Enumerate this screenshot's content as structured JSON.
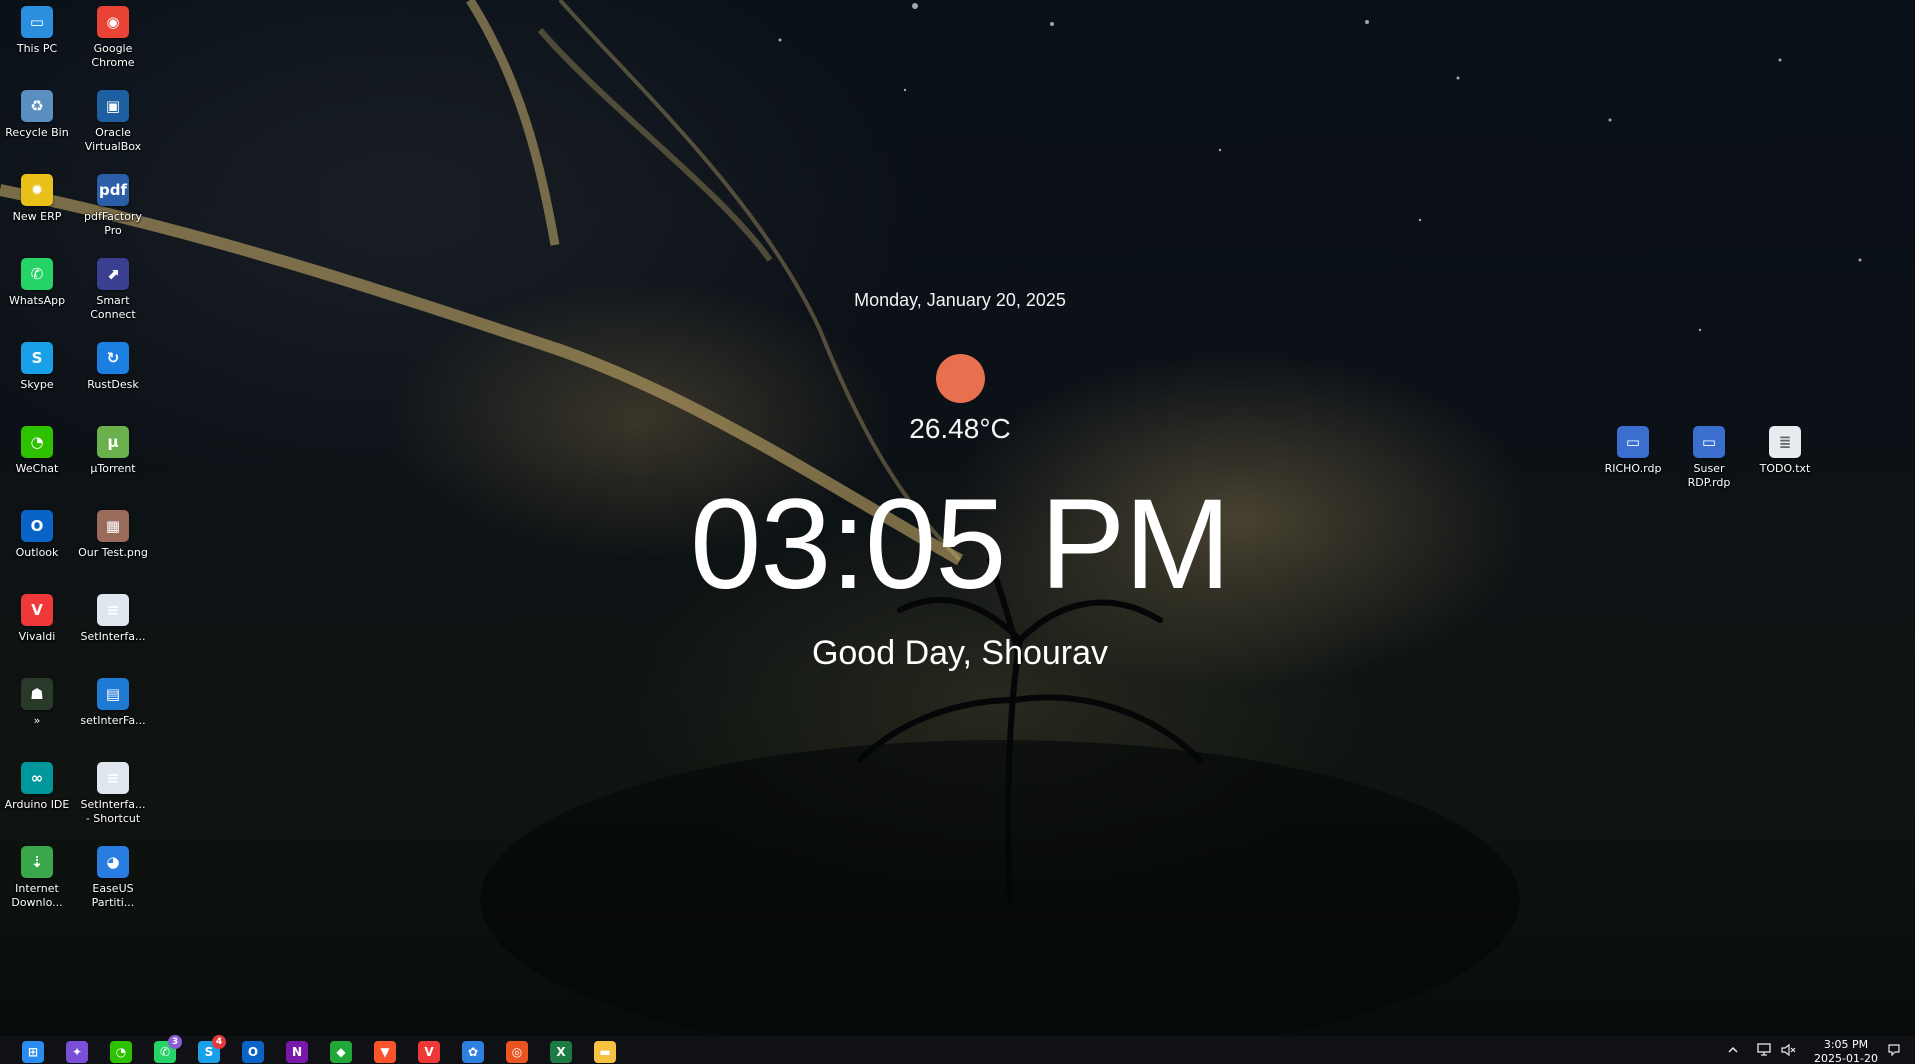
{
  "desktop": {
    "left_icons": [
      {
        "name": "this-pc",
        "label": "This PC",
        "icon": "monitor-icon",
        "color": "#2b8fe0",
        "glyph": "▭"
      },
      {
        "name": "google-chrome",
        "label": "Google\nChrome",
        "icon": "chrome-icon",
        "color": "#e84335",
        "glyph": "◉"
      },
      {
        "name": "recycle-bin",
        "label": "Recycle Bin",
        "icon": "recycle-bin-icon",
        "color": "#5a8fbf",
        "glyph": "♻"
      },
      {
        "name": "oracle-virtualbox",
        "label": "Oracle\nVirtualBox",
        "icon": "virtualbox-icon",
        "color": "#1d5fa0",
        "glyph": "▣"
      },
      {
        "name": "new-erp",
        "label": "New ERP",
        "icon": "erp-icon",
        "color": "#e8c21a",
        "glyph": "✹"
      },
      {
        "name": "pdffactory-pro",
        "label": "pdfFactory\nPro",
        "icon": "pdffactory-icon",
        "color": "#2a5ea8",
        "glyph": "pdf"
      },
      {
        "name": "whatsapp",
        "label": "WhatsApp",
        "icon": "whatsapp-icon",
        "color": "#25d366",
        "glyph": "✆"
      },
      {
        "name": "smart-connect",
        "label": "Smart\nConnect",
        "icon": "smart-connect-icon",
        "color": "#3a3f8f",
        "glyph": "⬈"
      },
      {
        "name": "skype",
        "label": "Skype",
        "icon": "skype-icon",
        "color": "#1aa0e8",
        "glyph": "S"
      },
      {
        "name": "rustdesk",
        "label": "RustDesk",
        "icon": "rustdesk-icon",
        "color": "#1a7fe0",
        "glyph": "↻"
      },
      {
        "name": "wechat",
        "label": "WeChat",
        "icon": "wechat-icon",
        "color": "#2dc100",
        "glyph": "◔"
      },
      {
        "name": "utorrent",
        "label": "µTorrent",
        "icon": "utorrent-icon",
        "color": "#6ab04c",
        "glyph": "µ"
      },
      {
        "name": "outlook",
        "label": "Outlook",
        "icon": "outlook-icon",
        "color": "#0a64c8",
        "glyph": "O"
      },
      {
        "name": "our-test-png",
        "label": "Our Test.png",
        "icon": "image-file-icon",
        "color": "#9a6a5a",
        "glyph": "▦"
      },
      {
        "name": "vivaldi",
        "label": "Vivaldi",
        "icon": "vivaldi-icon",
        "color": "#ef3939",
        "glyph": "V"
      },
      {
        "name": "setinterfa-1",
        "label": "SetInterfa...",
        "icon": "script-file-icon",
        "color": "#dfe6ee",
        "glyph": "≡"
      },
      {
        "name": "shortcut-unnamed",
        "label": "»",
        "icon": "shortcut-icon",
        "color": "#2a3a2a",
        "glyph": "☗"
      },
      {
        "name": "setinterfa-2",
        "label": "setInterFa...",
        "icon": "document-file-icon",
        "color": "#1f7ad4",
        "glyph": "▤"
      },
      {
        "name": "arduino-ide",
        "label": "Arduino IDE",
        "icon": "arduino-icon",
        "color": "#00979c",
        "glyph": "∞"
      },
      {
        "name": "setinterfa-shortcut",
        "label": "SetInterfa...\n- Shortcut",
        "icon": "script-shortcut-icon",
        "color": "#dfe6ee",
        "glyph": "≡"
      },
      {
        "name": "internet-download-manager",
        "label": "Internet\nDownlo...",
        "icon": "idm-icon",
        "color": "#3aa84a",
        "glyph": "⇣"
      },
      {
        "name": "easeus-partition",
        "label": "EaseUS\nPartiti...",
        "icon": "easeus-icon",
        "color": "#2a7de0",
        "glyph": "◕"
      }
    ],
    "right_icons": [
      {
        "name": "richo-rdp",
        "label": "RICHO.rdp",
        "icon": "rdp-file-icon",
        "color": "#3a6fd0",
        "glyph": "▭"
      },
      {
        "name": "suser-rdp",
        "label": "Suser\nRDP.rdp",
        "icon": "rdp-file-icon",
        "color": "#3a6fd0",
        "glyph": "▭"
      },
      {
        "name": "todo-txt",
        "label": "TODO.txt",
        "icon": "text-file-icon",
        "color": "#e8ecf0",
        "glyph": "≣"
      }
    ]
  },
  "widget": {
    "date": "Monday, January 20, 2025",
    "weather_icon": "sun-icon",
    "sun_color": "#e8704f",
    "temperature": "26.48°C",
    "time": "03:05 PM",
    "greeting": "Good Day, Shourav"
  },
  "taskbar": {
    "apps": [
      {
        "name": "start",
        "icon": "windows-start-icon",
        "color": "#2a8cf0",
        "glyph": "⊞",
        "badge": ""
      },
      {
        "name": "copilot-app",
        "icon": "copilot-icon",
        "color": "#7a4fd8",
        "glyph": "✦",
        "badge": ""
      },
      {
        "name": "wechat-app",
        "icon": "wechat-icon",
        "color": "#2dc100",
        "glyph": "◔",
        "badge": ""
      },
      {
        "name": "whatsapp-app",
        "icon": "whatsapp-icon",
        "color": "#25d366",
        "glyph": "✆",
        "badge": "3"
      },
      {
        "name": "skype-app",
        "icon": "skype-icon",
        "color": "#1aa0e8",
        "glyph": "S",
        "badge": "4"
      },
      {
        "name": "outlook-app",
        "icon": "outlook-icon",
        "color": "#0a64c8",
        "glyph": "O",
        "badge": ""
      },
      {
        "name": "onenote-app",
        "icon": "onenote-icon",
        "color": "#7719aa",
        "glyph": "N",
        "badge": ""
      },
      {
        "name": "anydesk-app",
        "icon": "remote-desktop-icon",
        "color": "#20a83a",
        "glyph": "◆",
        "badge": ""
      },
      {
        "name": "brave-app",
        "icon": "brave-icon",
        "color": "#fb542b",
        "glyph": "▼",
        "badge": ""
      },
      {
        "name": "vivaldi-app",
        "icon": "vivaldi-icon",
        "color": "#ef3939",
        "glyph": "V",
        "badge": ""
      },
      {
        "name": "photos-app",
        "icon": "photos-icon",
        "color": "#2d7fe0",
        "glyph": "✿",
        "badge": ""
      },
      {
        "name": "ubuntu-app",
        "icon": "ubuntu-icon",
        "color": "#e95420",
        "glyph": "◎",
        "badge": ""
      },
      {
        "name": "excel-app",
        "icon": "excel-icon",
        "color": "#1d7a45",
        "glyph": "X",
        "badge": ""
      },
      {
        "name": "file-explorer-app",
        "icon": "folder-icon",
        "color": "#f5c242",
        "glyph": "▬",
        "badge": ""
      }
    ],
    "tray": {
      "chevron_icon": "chevron-up-icon",
      "network_icon": "network-icon",
      "volume_icon": "volume-muted-icon",
      "time": "3:05 PM",
      "date": "2025-01-20",
      "notification_icon": "notification-icon"
    }
  }
}
